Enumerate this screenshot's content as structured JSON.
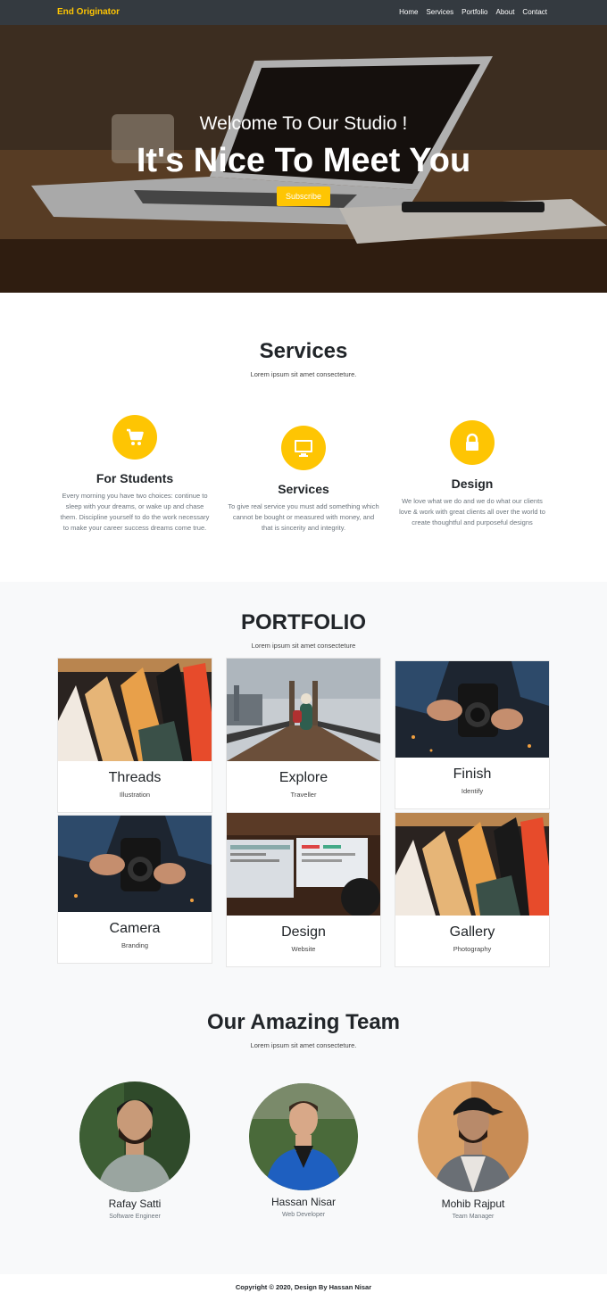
{
  "nav": {
    "brand": "End Originator",
    "links": [
      "Home",
      "Services",
      "Portfolio",
      "About",
      "Contact"
    ]
  },
  "hero": {
    "subtitle": "Welcome To Our Studio !",
    "title": "It's Nice To Meet You",
    "button": "Subscribe"
  },
  "services": {
    "title": "Services",
    "subtitle": "Lorem ipsum sit amet consecteture.",
    "items": [
      {
        "icon": "cart-icon",
        "title": "For Students",
        "text": "Every morning you have two choices: continue to sleep with your dreams, or wake up and chase them. Discipline yourself to do the work necessary to make your career success dreams come true."
      },
      {
        "icon": "monitor-icon",
        "title": "Services",
        "text": "To give real service you must add something which cannot be bought or measured with money, and that is sincerity and integrity."
      },
      {
        "icon": "lock-icon",
        "title": "Design",
        "text": "We love what we do and we do what our clients love & work with great clients all over the world to create thoughtful and purposeful designs"
      }
    ]
  },
  "portfolio": {
    "title": "PORTFOLIO",
    "subtitle": "Lorem ipsum sit amet consecteture",
    "items": [
      {
        "title": "Threads",
        "category": "Illustration"
      },
      {
        "title": "Explore",
        "category": "Traveller"
      },
      {
        "title": "Finish",
        "category": "Identify"
      },
      {
        "title": "Camera",
        "category": "Branding"
      },
      {
        "title": "Design",
        "category": "Website"
      },
      {
        "title": "Gallery",
        "category": "Photography"
      }
    ]
  },
  "team": {
    "title": "Our Amazing Team",
    "subtitle": "Lorem ipsum sit amet consecteture.",
    "members": [
      {
        "name": "Rafay Satti",
        "role": "Software Engineer"
      },
      {
        "name": "Hassan Nisar",
        "role": "Web Developer"
      },
      {
        "name": "Mohib Rajput",
        "role": "Team Manager"
      }
    ]
  },
  "footer": {
    "text": "Copyright © 2020, Design By Hassan Nisar"
  },
  "colors": {
    "accent": "#fec503",
    "nav": "#343a40",
    "light_bg": "#f8f9fa"
  }
}
